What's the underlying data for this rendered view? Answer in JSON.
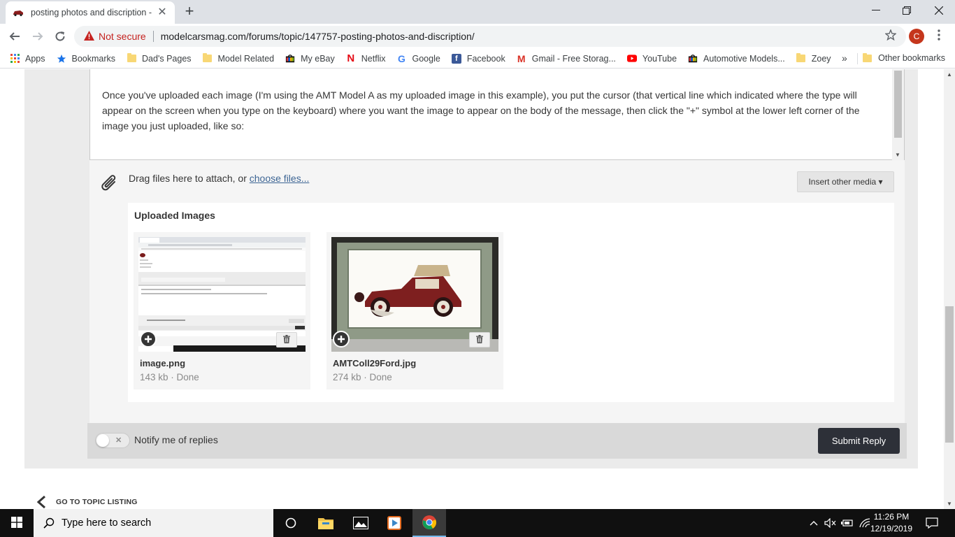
{
  "browser": {
    "tab_title": "posting photos and discription -",
    "tab_close": "✕",
    "new_tab": "+",
    "security_label": "Not secure",
    "url": "modelcarsmag.com/forums/topic/147757-posting-photos-and-discription/",
    "profile_initial": "C"
  },
  "bookmarks": [
    {
      "label": "Apps",
      "icon": "apps-grid-icon"
    },
    {
      "label": "Bookmarks",
      "icon": "star-icon"
    },
    {
      "label": "Dad's Pages",
      "icon": "folder-icon"
    },
    {
      "label": "Model Related",
      "icon": "folder-icon"
    },
    {
      "label": "My eBay",
      "icon": "ebay-icon"
    },
    {
      "label": "Netflix",
      "icon": "netflix-icon"
    },
    {
      "label": "Google",
      "icon": "google-icon"
    },
    {
      "label": "Facebook",
      "icon": "facebook-icon"
    },
    {
      "label": "Gmail - Free Storag...",
      "icon": "gmail-icon"
    },
    {
      "label": "YouTube",
      "icon": "youtube-icon"
    },
    {
      "label": "Automotive Models...",
      "icon": "ebay-icon"
    },
    {
      "label": "Zoey",
      "icon": "folder-icon"
    }
  ],
  "bookmarks_more": "»",
  "other_bookmarks": "Other bookmarks",
  "editor": {
    "body_text": "Once you've uploaded each image (I'm using the AMT Model A as my uploaded image in this example), you put the cursor (that vertical line which indicated where the type will appear on the screen when you type on the keyboard) where you want the image to appear on the body of the message, then click the \"+\" symbol at the lower left corner of the image you just uploaded, like so:"
  },
  "attach": {
    "drag_text": "Drag files here to attach, or ",
    "choose_files": "choose files...",
    "insert_media": "Insert other media ▾"
  },
  "uploads": {
    "title": "Uploaded Images",
    "items": [
      {
        "name": "image.png",
        "meta": "143 kb · Done"
      },
      {
        "name": "AMTColl29Ford.jpg",
        "meta": "274 kb · Done"
      }
    ]
  },
  "reply": {
    "notify_label": "Notify me of replies",
    "submit_label": "Submit Reply"
  },
  "goto_topic": "GO TO TOPIC LISTING",
  "taskbar": {
    "search_placeholder": "Type here to search",
    "time": "11:26 PM",
    "date": "12/19/2019"
  },
  "colors": {
    "submit_button": "#2d3038",
    "link": "#3d6594",
    "not_secure": "#c5221f"
  }
}
